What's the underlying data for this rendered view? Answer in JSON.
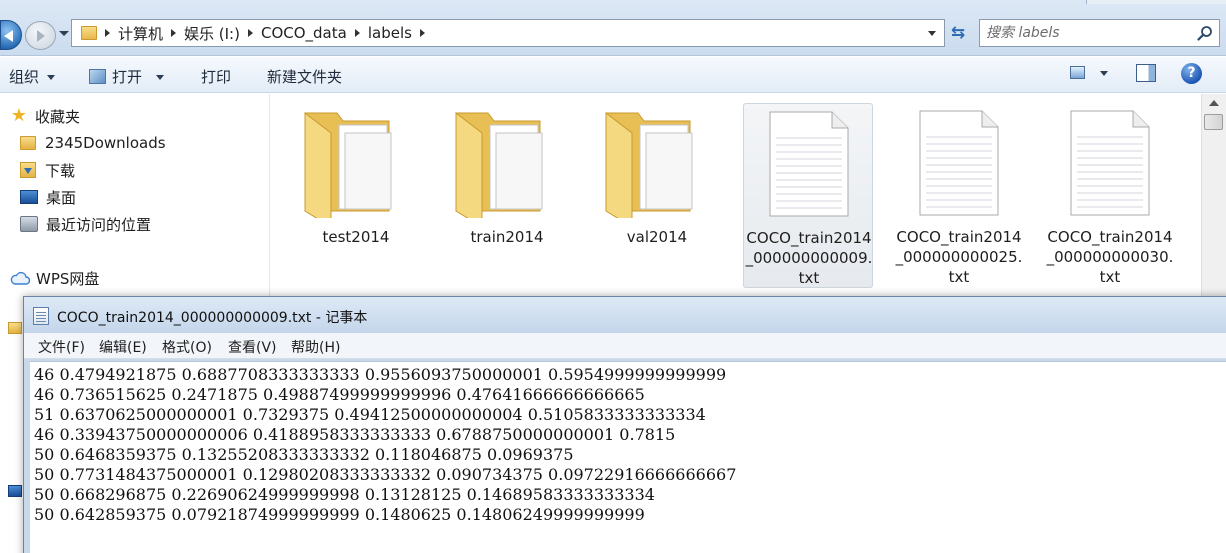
{
  "explorer": {
    "breadcrumb": [
      "计算机",
      "娱乐 (I:)",
      "COCO_data",
      "labels"
    ],
    "search_placeholder": "搜索 labels",
    "toolbar": {
      "organize": "组织",
      "open": "打开",
      "print": "打印",
      "new_folder": "新建文件夹"
    },
    "nav_pane": {
      "favorites": "收藏夹",
      "items": [
        "2345Downloads",
        "下载",
        "桌面",
        "最近访问的位置"
      ],
      "wps": "WPS网盘"
    },
    "files": [
      {
        "type": "folder",
        "label": "test2014"
      },
      {
        "type": "folder",
        "label": "train2014"
      },
      {
        "type": "folder",
        "label": "val2014"
      },
      {
        "type": "text",
        "label": "COCO_train2014_000000000009.txt",
        "selected": true
      },
      {
        "type": "text",
        "label": "COCO_train2014_000000000025.txt",
        "selected": false
      },
      {
        "type": "text",
        "label": "COCO_train2014_000000000030.txt",
        "selected": false
      }
    ]
  },
  "notepad": {
    "title": "COCO_train2014_000000000009.txt - 记事本",
    "menu": [
      "文件(F)",
      "编辑(E)",
      "格式(O)",
      "查看(V)",
      "帮助(H)"
    ],
    "lines": [
      "46 0.4794921875 0.6887708333333333 0.9556093750000001 0.5954999999999999",
      "46 0.736515625 0.2471875 0.49887499999999996 0.47641666666666665",
      "51 0.6370625000000001 0.7329375 0.49412500000000004 0.5105833333333334",
      "46 0.33943750000000006 0.4188958333333333 0.6788750000000001 0.7815",
      "50 0.6468359375 0.13255208333333332 0.118046875 0.0969375",
      "50 0.7731484375000001 0.12980208333333332 0.090734375 0.09722916666666667",
      "50 0.668296875 0.22690624999999998 0.13128125 0.14689583333333334",
      "50 0.642859375 0.07921874999999999 0.1480625 0.14806249999999999"
    ]
  },
  "colors": {
    "folder": "#f2cc66",
    "accent": "#2d6bb3",
    "titlebar": "#c4d6eb"
  }
}
